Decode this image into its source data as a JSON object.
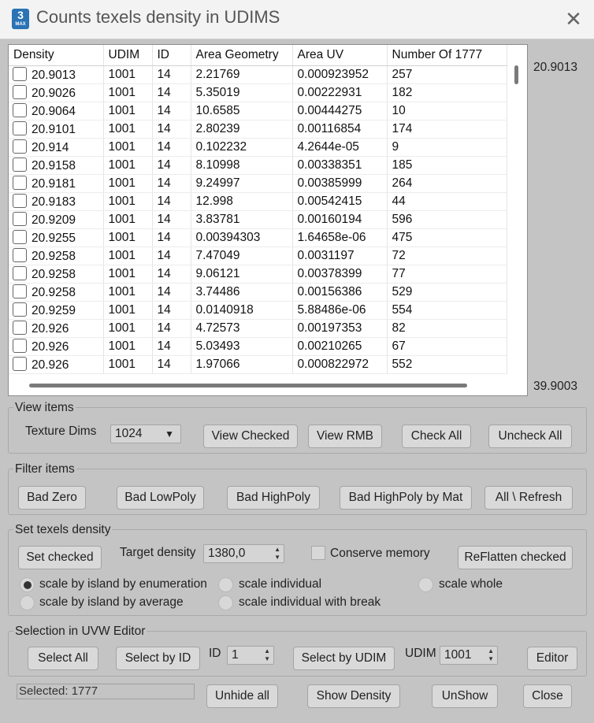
{
  "window": {
    "title": "Counts texels density in UDIMS",
    "app_icon_number": "3",
    "app_icon_label": "MAX"
  },
  "table": {
    "columns": [
      "Density",
      "UDIM",
      "ID",
      "Area Geometry",
      "Area UV",
      "Number Of 1777"
    ],
    "rows": [
      [
        "20.9013",
        "1001",
        "14",
        "2.21769",
        "0.000923952",
        "257"
      ],
      [
        "20.9026",
        "1001",
        "14",
        "5.35019",
        "0.00222931",
        "182"
      ],
      [
        "20.9064",
        "1001",
        "14",
        "10.6585",
        "0.00444275",
        "10"
      ],
      [
        "20.9101",
        "1001",
        "14",
        "2.80239",
        "0.00116854",
        "174"
      ],
      [
        "20.914",
        "1001",
        "14",
        "0.102232",
        "4.2644e-05",
        "9"
      ],
      [
        "20.9158",
        "1001",
        "14",
        "8.10998",
        "0.00338351",
        "185"
      ],
      [
        "20.9181",
        "1001",
        "14",
        "9.24997",
        "0.00385999",
        "264"
      ],
      [
        "20.9183",
        "1001",
        "14",
        "12.998",
        "0.00542415",
        "44"
      ],
      [
        "20.9209",
        "1001",
        "14",
        "3.83781",
        "0.00160194",
        "596"
      ],
      [
        "20.9255",
        "1001",
        "14",
        "0.00394303",
        "1.64658e-06",
        "475"
      ],
      [
        "20.9258",
        "1001",
        "14",
        "7.47049",
        "0.0031197",
        "72"
      ],
      [
        "20.9258",
        "1001",
        "14",
        "9.06121",
        "0.00378399",
        "77"
      ],
      [
        "20.9258",
        "1001",
        "14",
        "3.74486",
        "0.00156386",
        "529"
      ],
      [
        "20.9259",
        "1001",
        "14",
        "0.0140918",
        "5.88486e-06",
        "554"
      ],
      [
        "20.926",
        "1001",
        "14",
        "4.72573",
        "0.00197353",
        "82"
      ],
      [
        "20.926",
        "1001",
        "14",
        "5.03493",
        "0.00210265",
        "67"
      ],
      [
        "20.926",
        "1001",
        "14",
        "1.97066",
        "0.000822972",
        "552"
      ]
    ]
  },
  "density_range": {
    "min": "20.9013",
    "max": "39.9003"
  },
  "view_items": {
    "title": "View items",
    "texture_dims_label": "Texture Dims",
    "texture_dims_value": "1024",
    "view_checked": "View Checked",
    "view_rmb": "View RMB",
    "check_all": "Check All",
    "uncheck_all": "Uncheck All"
  },
  "filter_items": {
    "title": "Filter items",
    "bad_zero": "Bad Zero",
    "bad_lowpoly": "Bad LowPoly",
    "bad_highpoly": "Bad HighPoly",
    "bad_highpoly_by_mat": "Bad HighPoly by Mat",
    "all_refresh": "All \\ Refresh"
  },
  "set_density": {
    "title": "Set texels density",
    "set_checked": "Set checked",
    "target_label": "Target density",
    "target_value": "1380,0",
    "conserve_memory": "Conserve memory",
    "reflatten_checked": "ReFlatten checked",
    "radio_enum": "scale by island by enumeration",
    "radio_average": "scale by island by average",
    "radio_individual": "scale individual",
    "radio_individual_break": "scale individual with break",
    "radio_whole": "scale whole"
  },
  "selection": {
    "title": "Selection in UVW Editor",
    "select_all": "Select All",
    "select_by_id": "Select by ID",
    "id_label": "ID",
    "id_value": "1",
    "select_by_udim": "Select by UDIM",
    "udim_label": "UDIM",
    "udim_value": "1001",
    "editor": "Editor"
  },
  "footer": {
    "status": "Selected: 1777",
    "unhide_all": "Unhide all",
    "show_density": "Show Density",
    "unshow": "UnShow",
    "close": "Close"
  }
}
